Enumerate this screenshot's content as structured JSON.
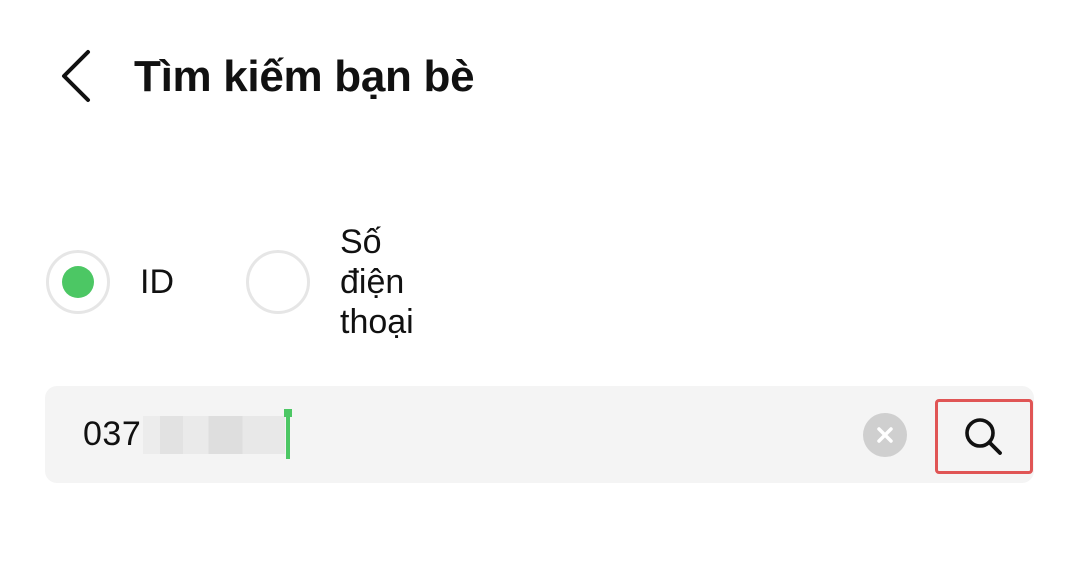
{
  "header": {
    "title": "Tìm kiếm bạn bè",
    "back_icon": "chevron-left-icon"
  },
  "search_type": {
    "options": [
      {
        "label": "ID",
        "selected": true
      },
      {
        "label": "Số điện thoại",
        "selected": false
      }
    ],
    "accent_color": "#4cc764"
  },
  "search": {
    "value_visible_prefix": "037",
    "value_masked": true,
    "clear_icon": "clear-icon",
    "search_icon": "search-icon",
    "highlight_color": "#e05555"
  }
}
